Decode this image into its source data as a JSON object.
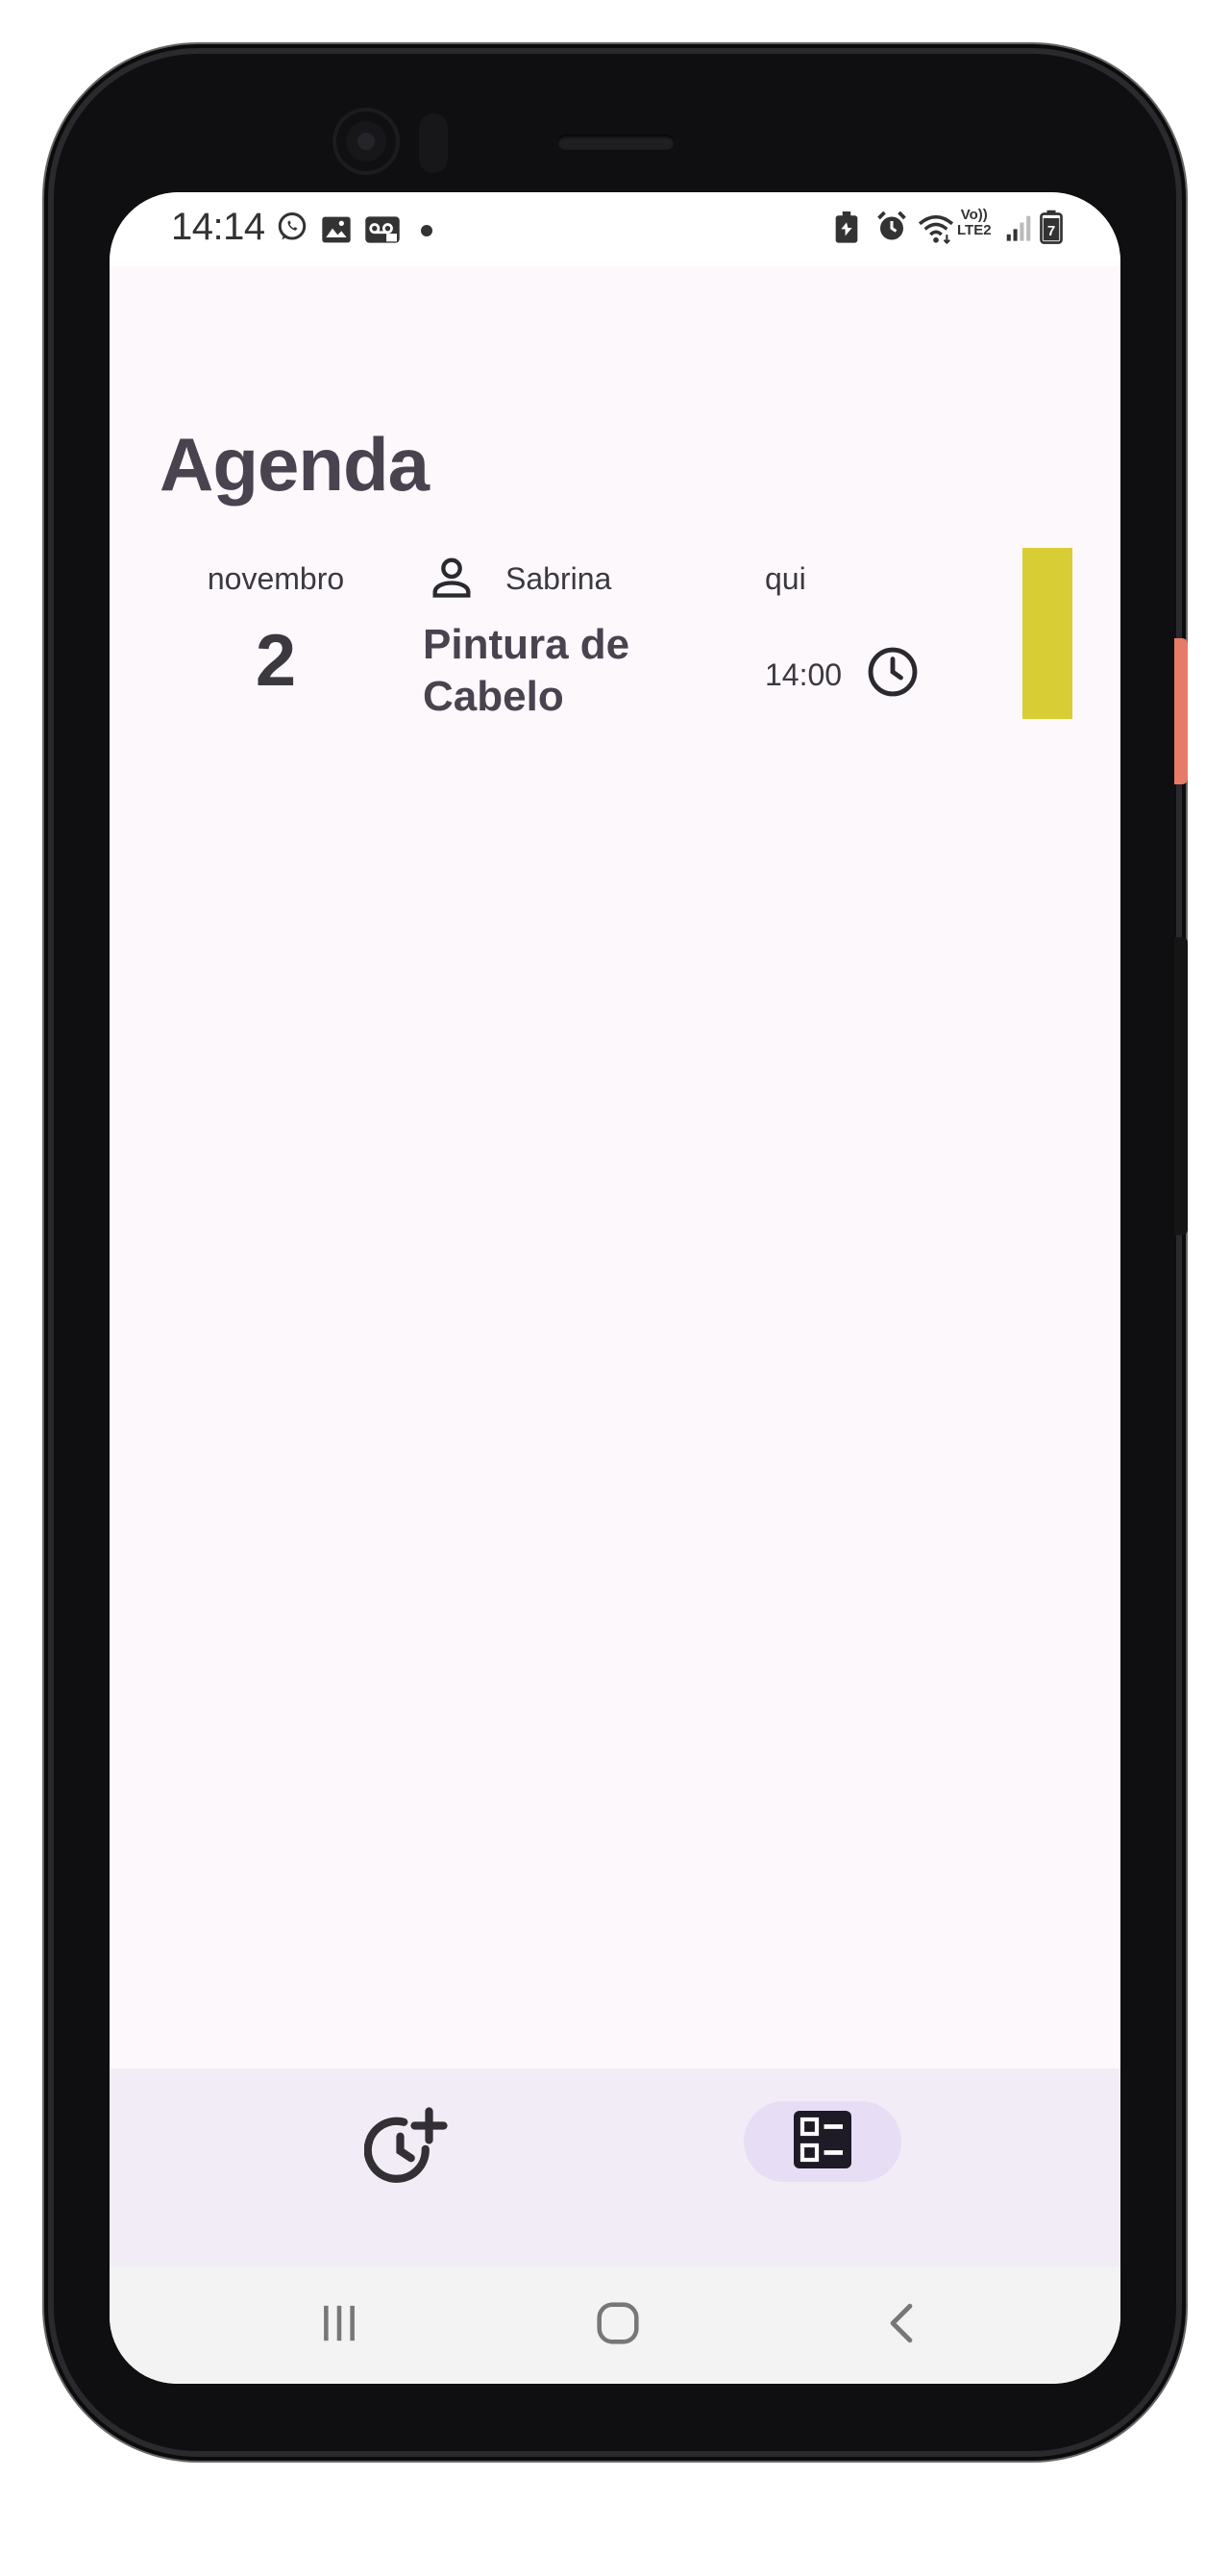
{
  "status_bar": {
    "time": "14:14",
    "left_icons": [
      "whatsapp-icon",
      "gallery-icon",
      "voicemail-icon",
      "notification-dot"
    ],
    "right_icons": [
      "battery-saver-icon",
      "alarm-icon",
      "wifi-icon",
      "volte-lte2-icon",
      "signal-icon",
      "battery-icon"
    ],
    "network_label_1": "Vo))",
    "network_label_2": "LTE2",
    "battery_level": "7"
  },
  "header": {
    "title": "Agenda"
  },
  "appointments": [
    {
      "month": "novembro",
      "day": "2",
      "client": "Sabrina",
      "service": "Pintura de Cabelo",
      "weekday": "qui",
      "time": "14:00",
      "color": "#d8cd35"
    }
  ],
  "bottom_nav": {
    "items": [
      {
        "icon": "add-schedule-icon",
        "selected": false
      },
      {
        "icon": "agenda-list-icon",
        "selected": true
      }
    ],
    "selected_color": "#e7def6"
  },
  "system_nav": [
    "recents-icon",
    "home-icon",
    "back-icon"
  ]
}
